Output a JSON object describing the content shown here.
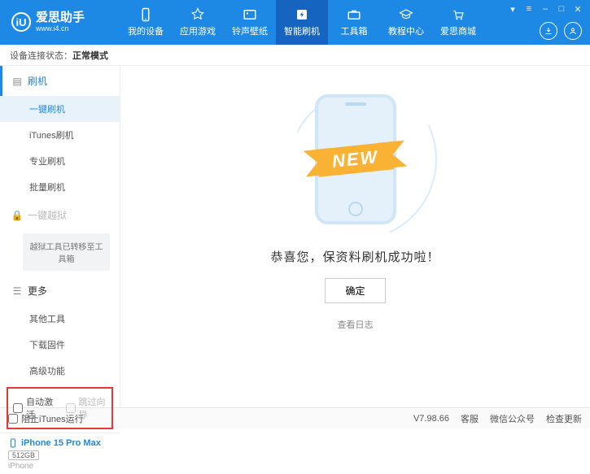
{
  "logo": {
    "badge": "iU",
    "title": "爱思助手",
    "url": "www.i4.cn"
  },
  "topnav": [
    {
      "label": "我的设备"
    },
    {
      "label": "应用游戏"
    },
    {
      "label": "铃声壁纸"
    },
    {
      "label": "智能刷机"
    },
    {
      "label": "工具箱"
    },
    {
      "label": "教程中心"
    },
    {
      "label": "爱思商城"
    }
  ],
  "status": {
    "prefix": "设备连接状态：",
    "mode": "正常模式"
  },
  "sidebar": {
    "flash_head": "刷机",
    "flash_items": [
      "一键刷机",
      "iTunes刷机",
      "专业刷机",
      "批量刷机"
    ],
    "jailbreak_head": "一键越狱",
    "jailbreak_note": "越狱工具已转移至工具箱",
    "more_head": "更多",
    "more_items": [
      "其他工具",
      "下载固件",
      "高级功能"
    ],
    "auto_activate": "自动激活",
    "skip_guide": "跳过向导"
  },
  "device": {
    "name": "iPhone 15 Pro Max",
    "storage": "512GB",
    "type": "iPhone"
  },
  "main": {
    "ribbon": "NEW",
    "message": "恭喜您，保资料刷机成功啦！",
    "ok": "确定",
    "view_log": "查看日志"
  },
  "footer": {
    "block_itunes": "阻止iTunes运行",
    "version": "V7.98.66",
    "service": "客服",
    "wechat": "微信公众号",
    "check_update": "检查更新"
  }
}
